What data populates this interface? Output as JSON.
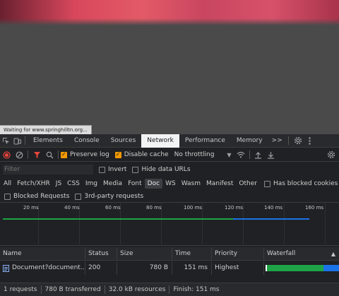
{
  "page": {
    "status_text": "Waiting for www.springhilltn.org..."
  },
  "tabs": {
    "items": [
      "Elements",
      "Console",
      "Sources",
      "Network",
      "Performance",
      "Memory"
    ],
    "more": ">>"
  },
  "toolbar": {
    "preserve_log": "Preserve log",
    "disable_cache": "Disable cache",
    "throttling": "No throttling"
  },
  "filter": {
    "placeholder": "Filter",
    "invert": "Invert",
    "hide_data_urls": "Hide data URLs"
  },
  "types": {
    "items": [
      "All",
      "Fetch/XHR",
      "JS",
      "CSS",
      "Img",
      "Media",
      "Font",
      "Doc",
      "WS",
      "Wasm",
      "Manifest",
      "Other"
    ],
    "selected": "Doc",
    "has_blocked_cookies": "Has blocked cookies"
  },
  "blocked": {
    "blocked_requests": "Blocked Requests",
    "third_party": "3rd-party requests"
  },
  "overview": {
    "ticks": [
      "20 ms",
      "40 ms",
      "60 ms",
      "80 ms",
      "100 ms",
      "120 ms",
      "140 ms",
      "160 ms"
    ]
  },
  "table": {
    "headers": [
      "Name",
      "Status",
      "Size",
      "Time",
      "Priority",
      "Waterfall"
    ],
    "rows": [
      {
        "name": "Document?document...",
        "status": "200",
        "size": "780 B",
        "time": "151 ms",
        "priority": "Highest"
      }
    ]
  },
  "summary": {
    "requests": "1 requests",
    "transferred": "780 B transferred",
    "resources": "32.0 kB resources",
    "finish": "Finish: 151 ms"
  },
  "colors": {
    "accent": "#f29900",
    "waterfall_green": "#1ea446",
    "waterfall_blue": "#1a73e8",
    "record_red": "#e8453c"
  }
}
